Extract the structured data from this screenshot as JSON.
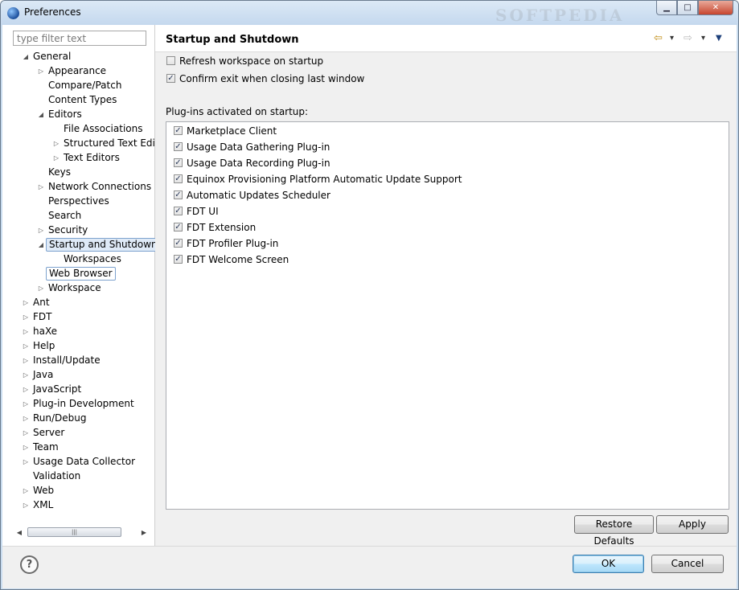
{
  "window": {
    "title": "Preferences",
    "watermark": "SOFTPEDIA",
    "controls": {
      "minimize": "▁",
      "maximize": "□",
      "close": "✕"
    }
  },
  "sidebar": {
    "filter_placeholder": "type filter text",
    "tree": [
      {
        "label": "General",
        "indent": 0,
        "twisty": "expanded"
      },
      {
        "label": "Appearance",
        "indent": 1,
        "twisty": "collapsed"
      },
      {
        "label": "Compare/Patch",
        "indent": 1,
        "twisty": "none"
      },
      {
        "label": "Content Types",
        "indent": 1,
        "twisty": "none"
      },
      {
        "label": "Editors",
        "indent": 1,
        "twisty": "expanded"
      },
      {
        "label": "File Associations",
        "indent": 2,
        "twisty": "none"
      },
      {
        "label": "Structured Text Edit",
        "indent": 2,
        "twisty": "collapsed"
      },
      {
        "label": "Text Editors",
        "indent": 2,
        "twisty": "collapsed"
      },
      {
        "label": "Keys",
        "indent": 1,
        "twisty": "none"
      },
      {
        "label": "Network Connections",
        "indent": 1,
        "twisty": "collapsed"
      },
      {
        "label": "Perspectives",
        "indent": 1,
        "twisty": "none"
      },
      {
        "label": "Search",
        "indent": 1,
        "twisty": "none"
      },
      {
        "label": "Security",
        "indent": 1,
        "twisty": "collapsed"
      },
      {
        "label": "Startup and Shutdown",
        "indent": 1,
        "twisty": "expanded",
        "state": "selected"
      },
      {
        "label": "Workspaces",
        "indent": 2,
        "twisty": "none"
      },
      {
        "label": "Web Browser",
        "indent": 1,
        "twisty": "none",
        "state": "focused"
      },
      {
        "label": "Workspace",
        "indent": 1,
        "twisty": "collapsed"
      },
      {
        "label": "Ant",
        "indent": 0,
        "twisty": "collapsed"
      },
      {
        "label": "FDT",
        "indent": 0,
        "twisty": "collapsed"
      },
      {
        "label": "haXe",
        "indent": 0,
        "twisty": "collapsed"
      },
      {
        "label": "Help",
        "indent": 0,
        "twisty": "collapsed"
      },
      {
        "label": "Install/Update",
        "indent": 0,
        "twisty": "collapsed"
      },
      {
        "label": "Java",
        "indent": 0,
        "twisty": "collapsed"
      },
      {
        "label": "JavaScript",
        "indent": 0,
        "twisty": "collapsed"
      },
      {
        "label": "Plug-in Development",
        "indent": 0,
        "twisty": "collapsed"
      },
      {
        "label": "Run/Debug",
        "indent": 0,
        "twisty": "collapsed"
      },
      {
        "label": "Server",
        "indent": 0,
        "twisty": "collapsed"
      },
      {
        "label": "Team",
        "indent": 0,
        "twisty": "collapsed"
      },
      {
        "label": "Usage Data Collector",
        "indent": 0,
        "twisty": "collapsed"
      },
      {
        "label": "Validation",
        "indent": 0,
        "twisty": "none"
      },
      {
        "label": "Web",
        "indent": 0,
        "twisty": "collapsed"
      },
      {
        "label": "XML",
        "indent": 0,
        "twisty": "collapsed"
      }
    ],
    "scrollbar": {
      "left_arrow": "◀",
      "right_arrow": "▶",
      "grip": "|||"
    }
  },
  "panel": {
    "title": "Startup and Shutdown",
    "nav": {
      "back": "⇦",
      "back_menu": "▾",
      "forward": "⇨",
      "forward_menu": "▾",
      "view_menu": "▼"
    },
    "options": [
      {
        "label": "Refresh workspace on startup",
        "checked": false
      },
      {
        "label": "Confirm exit when closing last window",
        "checked": true
      }
    ],
    "plugins_label": "Plug-ins activated on startup:",
    "plugins": [
      {
        "label": "Marketplace Client",
        "checked": true
      },
      {
        "label": "Usage Data Gathering Plug-in",
        "checked": true
      },
      {
        "label": "Usage Data Recording Plug-in",
        "checked": true
      },
      {
        "label": "Equinox Provisioning Platform Automatic Update Support",
        "checked": true
      },
      {
        "label": "Automatic Updates Scheduler",
        "checked": true
      },
      {
        "label": "FDT UI",
        "checked": true
      },
      {
        "label": "FDT Extension",
        "checked": true
      },
      {
        "label": "FDT Profiler Plug-in",
        "checked": true
      },
      {
        "label": "FDT Welcome Screen",
        "checked": true
      }
    ],
    "restore_defaults": "Restore Defaults",
    "apply": "Apply"
  },
  "footer": {
    "help": "?",
    "ok": "OK",
    "cancel": "Cancel"
  },
  "colors": {
    "selection_bg": "#dfeaf7",
    "selection_border": "#7da2ce",
    "default_button": "#bee6fd",
    "close_button": "#c7462f"
  }
}
